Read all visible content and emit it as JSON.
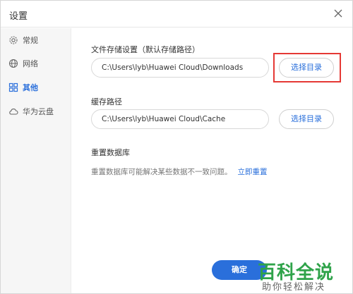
{
  "window": {
    "title": "设置"
  },
  "sidebar": {
    "items": [
      {
        "label": "常规",
        "icon": "gear-icon"
      },
      {
        "label": "网络",
        "icon": "globe-icon"
      },
      {
        "label": "其他",
        "icon": "grid-icon",
        "active": true
      },
      {
        "label": "华为云盘",
        "icon": "cloud-icon"
      }
    ]
  },
  "storage": {
    "title": "文件存储设置（默认存储路径）",
    "path": "C:\\Users\\lyb\\Huawei Cloud\\Downloads",
    "button": "选择目录"
  },
  "cache": {
    "title": "缓存路径",
    "path": "C:\\Users\\lyb\\Huawei Cloud\\Cache",
    "button": "选择目录"
  },
  "reset": {
    "title": "重置数据库",
    "desc": "重置数据库可能解决某些数据不一致问题。",
    "link": "立即重置"
  },
  "footer": {
    "ok": "确定"
  },
  "watermark": {
    "line1": "百科全说",
    "line2": "助你轻松解决"
  },
  "colors": {
    "accent": "#2a6fdb",
    "highlight": "#e53935",
    "watermark": "#2fa34a"
  }
}
